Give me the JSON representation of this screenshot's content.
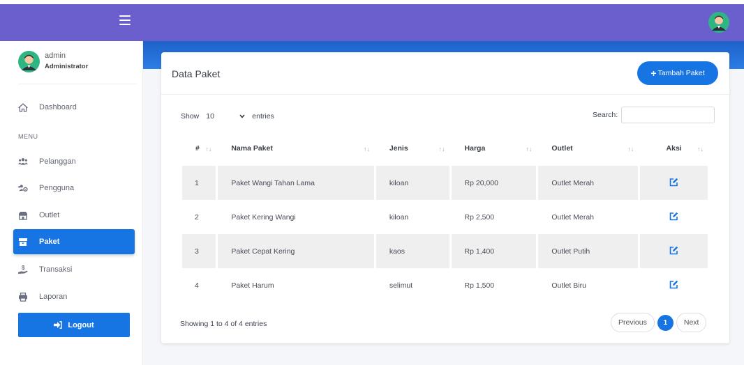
{
  "header": {
    "menu_icon": "hamburger-icon"
  },
  "user": {
    "name": "admin",
    "role": "Administrator"
  },
  "sidebar": {
    "menu_label": "MENU",
    "items": [
      {
        "label": "Dashboard",
        "icon": "home-icon"
      },
      {
        "label": "Pelanggan",
        "icon": "users-icon"
      },
      {
        "label": "Pengguna",
        "icon": "users-cog-icon"
      },
      {
        "label": "Outlet",
        "icon": "store-icon"
      },
      {
        "label": "Paket",
        "icon": "box-icon"
      },
      {
        "label": "Transaksi",
        "icon": "hand-coin-icon"
      },
      {
        "label": "Laporan",
        "icon": "printer-icon"
      }
    ],
    "active": "Paket",
    "logout_label": "Logout"
  },
  "colors": {
    "topbar": "#6a5fcd",
    "accent": "#1674e3"
  },
  "card": {
    "title": "Data Paket",
    "add_label": "Tambah Paket",
    "show_label": "Show",
    "entries_value": "10",
    "entries_label": "entries",
    "search_label": "Search:",
    "search_value": "",
    "columns": [
      "#",
      "Nama Paket",
      "Jenis",
      "Harga",
      "Outlet",
      "Aksi"
    ],
    "rows": [
      {
        "no": "1",
        "nama": "Paket Wangi Tahan Lama",
        "jenis": "kiloan",
        "harga": "Rp 20,000",
        "outlet": "Outlet Merah"
      },
      {
        "no": "2",
        "nama": "Paket Kering Wangi",
        "jenis": "kiloan",
        "harga": "Rp 2,500",
        "outlet": "Outlet Merah"
      },
      {
        "no": "3",
        "nama": "Paket Cepat Kering",
        "jenis": "kaos",
        "harga": "Rp 1,400",
        "outlet": "Outlet Putih"
      },
      {
        "no": "4",
        "nama": "Paket Harum",
        "jenis": "selimut",
        "harga": "Rp 1,500",
        "outlet": "Outlet Biru"
      }
    ],
    "info": "Showing 1 to 4 of 4 entries",
    "pagination": {
      "previous": "Previous",
      "current": "1",
      "next": "Next"
    }
  }
}
